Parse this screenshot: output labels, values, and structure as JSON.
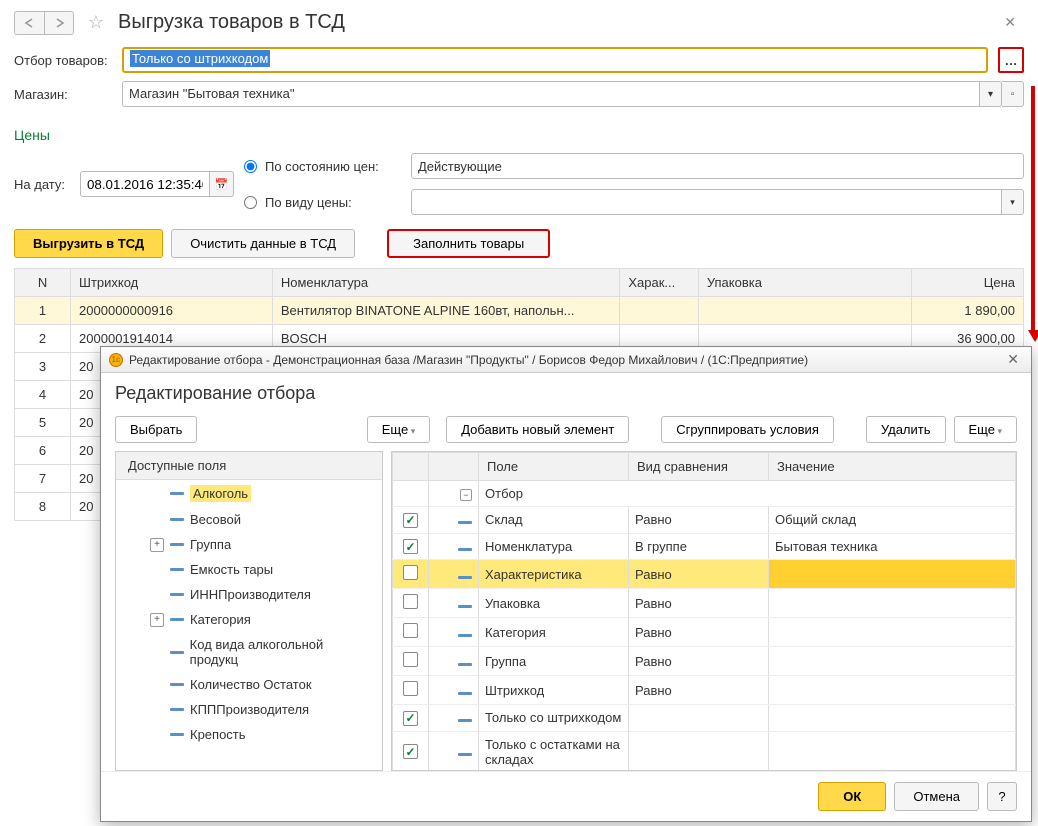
{
  "header": {
    "title": "Выгрузка товаров в ТСД"
  },
  "form": {
    "filter_label": "Отбор товаров:",
    "filter_value": "Только со штрихкодом",
    "store_label": "Магазин:",
    "store_value": "Магазин \"Бытовая техника\""
  },
  "prices": {
    "section": "Цены",
    "date_label": "На дату:",
    "date_value": "08.01.2016 12:35:40",
    "radio_state": "По состоянию цен:",
    "radio_type": "По виду цены:",
    "state_value": "Действующие"
  },
  "buttons": {
    "export": "Выгрузить в ТСД",
    "clear": "Очистить данные в ТСД",
    "fill": "Заполнить товары"
  },
  "table": {
    "headers": {
      "n": "N",
      "barcode": "Штрихкод",
      "nom": "Номенклатура",
      "char": "Харак...",
      "pack": "Упаковка",
      "price": "Цена"
    },
    "rows": [
      {
        "n": "1",
        "barcode": "2000000000916",
        "nom": "Вентилятор BINATONE ALPINE 160вт, напольн...",
        "price": "1 890,00"
      },
      {
        "n": "2",
        "barcode": "2000001914014",
        "nom": "BOSCH",
        "price": "36 900,00"
      },
      {
        "n": "3",
        "barcode": "20"
      },
      {
        "n": "4",
        "barcode": "20"
      },
      {
        "n": "5",
        "barcode": "20"
      },
      {
        "n": "6",
        "barcode": "20"
      },
      {
        "n": "7",
        "barcode": "20"
      },
      {
        "n": "8",
        "barcode": "20"
      }
    ]
  },
  "dialog": {
    "titlebar": "Редактирование отбора - Демонстрационная база /Магазин \"Продукты\" / Борисов Федор Михайлович /  (1С:Предприятие)",
    "title": "Редактирование отбора",
    "toolbar": {
      "select": "Выбрать",
      "more1": "Еще",
      "add": "Добавить новый элемент",
      "group": "Сгруппировать условия",
      "delete": "Удалить",
      "more2": "Еще"
    },
    "left": {
      "header": "Доступные поля",
      "items": [
        {
          "exp": "",
          "label": "Алкоголь",
          "hl": true
        },
        {
          "exp": "",
          "label": "Весовой"
        },
        {
          "exp": "+",
          "label": "Группа"
        },
        {
          "exp": "",
          "label": "Емкость тары"
        },
        {
          "exp": "",
          "label": "ИННПроизводителя"
        },
        {
          "exp": "+",
          "label": "Категория"
        },
        {
          "exp": "",
          "label": "Код вида алкогольной продукц"
        },
        {
          "exp": "",
          "label": "Количество Остаток"
        },
        {
          "exp": "",
          "label": "КПППроизводителя"
        },
        {
          "exp": "",
          "label": "Крепость"
        }
      ]
    },
    "right": {
      "headers": {
        "field": "Поле",
        "cmp": "Вид сравнения",
        "val": "Значение"
      },
      "root": "Отбор",
      "rows": [
        {
          "chk": true,
          "field": "Склад",
          "cmp": "Равно",
          "val": "Общий склад"
        },
        {
          "chk": true,
          "field": "Номенклатура",
          "cmp": "В группе",
          "val": "Бытовая техника"
        },
        {
          "chk": false,
          "field": "Характеристика",
          "cmp": "Равно",
          "val": "",
          "sel": true
        },
        {
          "chk": false,
          "field": "Упаковка",
          "cmp": "Равно",
          "val": ""
        },
        {
          "chk": false,
          "field": "Категория",
          "cmp": "Равно",
          "val": ""
        },
        {
          "chk": false,
          "field": "Группа",
          "cmp": "Равно",
          "val": ""
        },
        {
          "chk": false,
          "field": "Штрихкод",
          "cmp": "Равно",
          "val": ""
        },
        {
          "chk": true,
          "field": "Только со штрихкодом",
          "cmp": "",
          "val": ""
        },
        {
          "chk": true,
          "field": "Только с остатками на складах",
          "cmp": "",
          "val": ""
        }
      ]
    },
    "footer": {
      "ok": "ОК",
      "cancel": "Отмена",
      "help": "?"
    }
  }
}
